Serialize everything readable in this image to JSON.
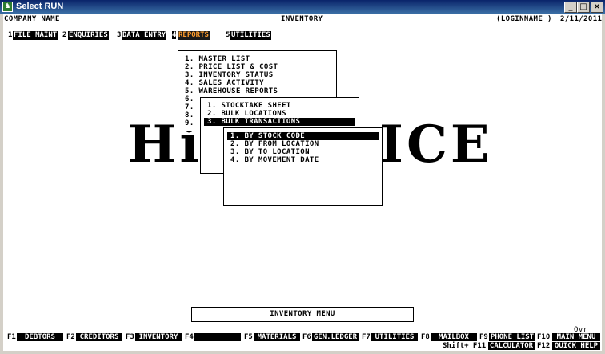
{
  "window": {
    "title": "Select RUN",
    "minimize": "_",
    "maximize": "□",
    "close": "×"
  },
  "header": {
    "company": "COMPANY NAME",
    "module": "INVENTORY",
    "login": "(LOGINNAME )",
    "date": "2/11/2011"
  },
  "menubar": [
    {
      "key": "1",
      "label": "FILE MAINT"
    },
    {
      "key": "2",
      "label": "ENQUIRIES"
    },
    {
      "key": "3",
      "label": "DATA ENTRY"
    },
    {
      "key": "4",
      "label": "REPORTS"
    },
    {
      "key": "5",
      "label": "UTILITIES"
    }
  ],
  "reports_menu": [
    "1. MASTER LIST",
    "2. PRICE LIST & COST",
    "3. INVENTORY STATUS",
    "4. SALES ACTIVITY",
    "5. WAREHOUSE REPORTS",
    "6.",
    "7.",
    "8.",
    "9."
  ],
  "warehouse_menu": [
    "1. STOCKTAKE SHEET",
    "2. BULK LOCATIONS",
    "3. BULK TRANSACTIONS"
  ],
  "transactions_menu": [
    "1. BY STOCK CODE",
    "2. BY FROM LOCATION",
    "3. BY TO LOCATION",
    "4. BY MOVEMENT DATE"
  ],
  "background_logo": {
    "left": "Hi",
    "right": "ICE"
  },
  "status_box": "INVENTORY MENU",
  "ovr": "Ovr",
  "function_keys": [
    {
      "key": "F1",
      "label": "DEBTORS"
    },
    {
      "key": "F2",
      "label": "CREDITORS"
    },
    {
      "key": "F3",
      "label": "INVENTORY"
    },
    {
      "key": "F4",
      "label": ""
    },
    {
      "key": "F5",
      "label": "MATERIALS"
    },
    {
      "key": "F6",
      "label": "GEN.LEDGER"
    },
    {
      "key": "F7",
      "label": "UTILITIES"
    },
    {
      "key": "F8",
      "label": "MAILBOX"
    },
    {
      "key": "F9",
      "label": "PHONE LIST"
    },
    {
      "key": "F10",
      "label": "MAIN MENU"
    }
  ],
  "function_keys_shift": [
    {
      "key": "Shift+ F11",
      "label": "CALCULATOR"
    },
    {
      "key": "F12",
      "label": "QUICK HELP"
    }
  ]
}
